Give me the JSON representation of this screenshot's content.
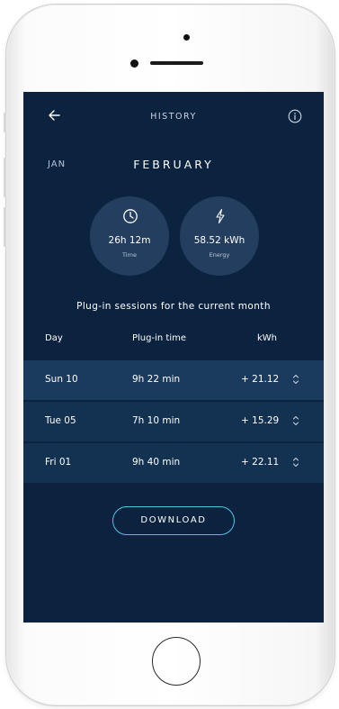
{
  "header": {
    "title": "HISTORY",
    "back_icon": "arrow-left-icon",
    "info_icon": "info-icon"
  },
  "months": {
    "previous": "JAN",
    "current": "FEBRUARY"
  },
  "stats": [
    {
      "icon": "clock-icon",
      "value": "26h 12m",
      "label": "Time"
    },
    {
      "icon": "lightning-icon",
      "value": "58.52 kWh",
      "label": "Energy"
    }
  ],
  "sessions": {
    "title": "Plug-in sessions for the current month",
    "columns": {
      "day": "Day",
      "time": "Plug-in time",
      "kwh": "kWh"
    },
    "rows": [
      {
        "day": "Sun 10",
        "time": "9h 22 min",
        "kwh": "+ 21.12"
      },
      {
        "day": "Tue 05",
        "time": "7h 10 min",
        "kwh": "+ 15.29"
      },
      {
        "day": "Fri 01",
        "time": "9h 40 min",
        "kwh": "+ 22.11"
      }
    ]
  },
  "actions": {
    "download_label": "DOWNLOAD"
  },
  "colors": {
    "screen_bg": "#0c2340",
    "circle_bg": "#243e60",
    "row_highlight": "#1a3a5e",
    "row_bg": "#133150",
    "accent": "#4fc3e6"
  }
}
